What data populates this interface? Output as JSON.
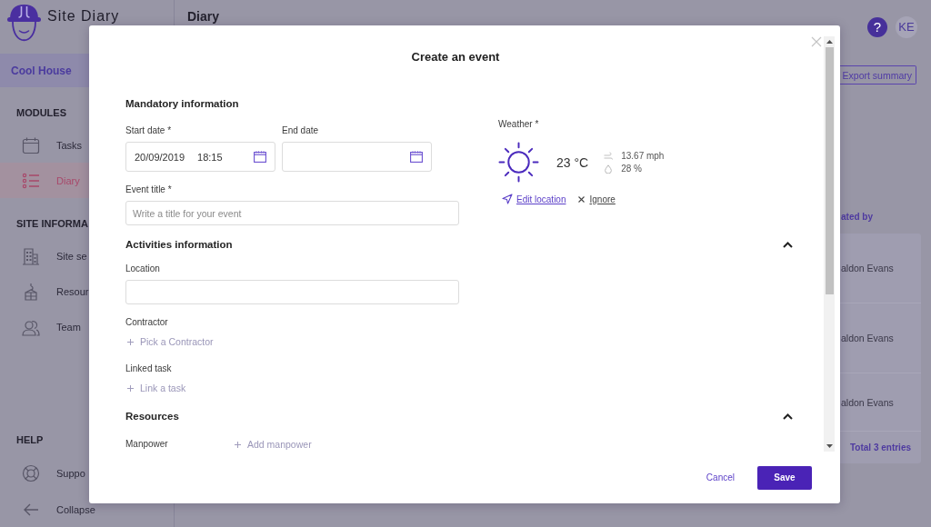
{
  "sidebar": {
    "app_name": "Site Diary",
    "project": "Cool House",
    "sections": [
      {
        "title": "MODULES",
        "items": [
          {
            "label": "Tasks",
            "selected": false
          },
          {
            "label": "Diary",
            "selected": true
          }
        ]
      },
      {
        "title": "SITE INFORMA",
        "items": [
          {
            "label": "Site se",
            "selected": false
          },
          {
            "label": "Resour",
            "selected": false
          },
          {
            "label": "Team",
            "selected": false
          }
        ]
      },
      {
        "title": "HELP",
        "items": [
          {
            "label": "Suppo",
            "selected": false
          }
        ]
      }
    ],
    "collapse": "Collapse"
  },
  "header": {
    "title": "Diary",
    "help": "?",
    "avatar": "KE"
  },
  "export_button": "Export summary",
  "table": {
    "columns": [
      "ated by"
    ],
    "rows": [
      [
        "aldon Evans"
      ],
      [
        "aldon Evans"
      ],
      [
        "aldon Evans"
      ]
    ],
    "footer": "Total 3 entries"
  },
  "dialog": {
    "title": "Create an event",
    "mandatory": {
      "title": "Mandatory information",
      "start_date": {
        "label": "Start date *",
        "date": "20/09/2019",
        "time": "18:15"
      },
      "end_date": {
        "label": "End date"
      },
      "event_title": {
        "label": "Event title *",
        "placeholder": "Write a title for your event"
      },
      "weather": {
        "label": "Weather *",
        "temperature": "23 °C",
        "wind": "13.67 mph",
        "humidity": "28 %",
        "edit_location": "Edit location",
        "ignore": "Ignore"
      }
    },
    "activities": {
      "title": "Activities information",
      "expanded": true,
      "location": {
        "label": "Location"
      },
      "contractor": {
        "label": "Contractor",
        "action": "Pick a Contractor"
      },
      "linked_task": {
        "label": "Linked task",
        "action": "Link a task"
      }
    },
    "resources": {
      "title": "Resources",
      "expanded": true,
      "manpower": {
        "label": "Manpower",
        "action": "Add manpower"
      }
    },
    "buttons": {
      "cancel": "Cancel",
      "save": "Save"
    }
  }
}
